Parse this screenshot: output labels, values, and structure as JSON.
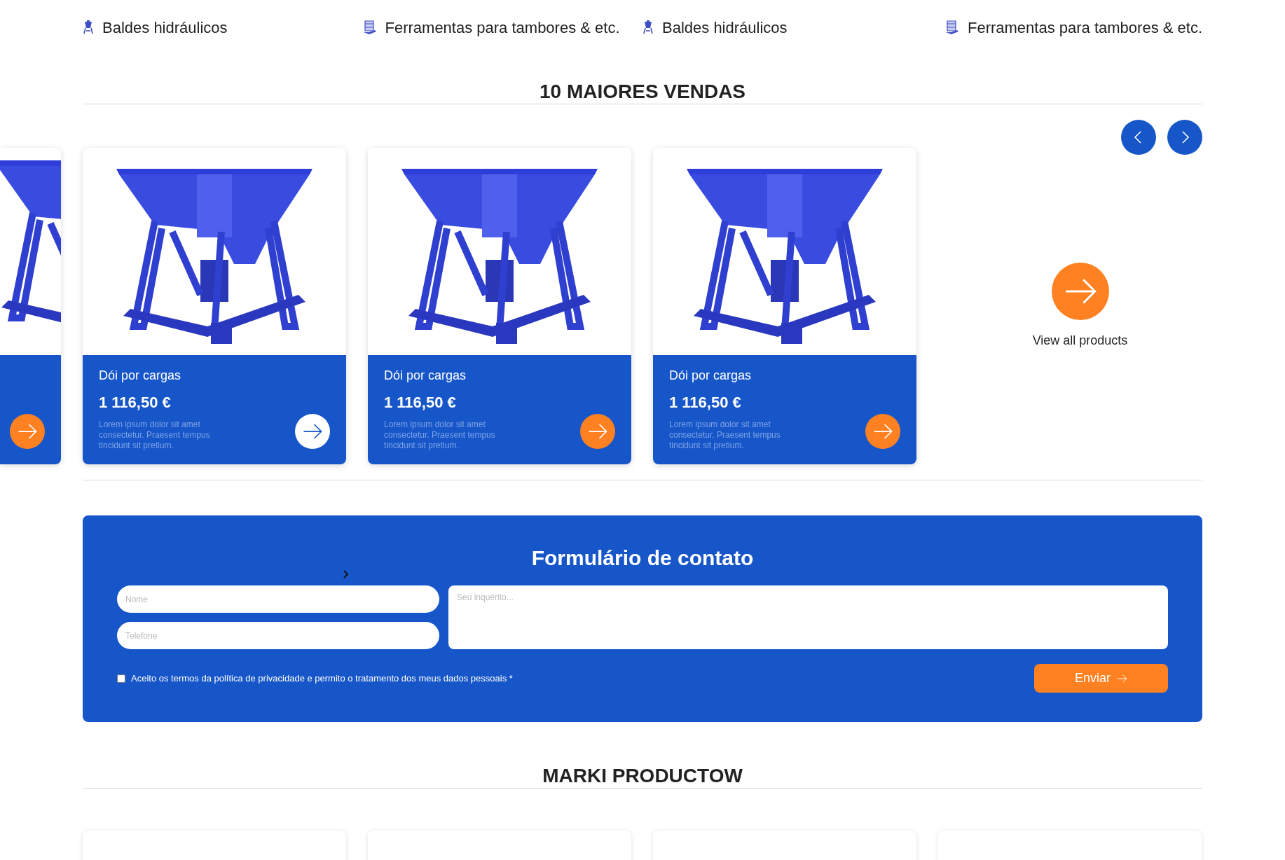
{
  "categories": [
    {
      "label": "Baldes hidráulicos",
      "kind": "bucket"
    },
    {
      "label": "Ferramentas para tambores & etc.",
      "kind": "drum"
    },
    {
      "label": "Baldes hidráulicos",
      "kind": "bucket"
    },
    {
      "label": "Ferramentas para tambores & etc.",
      "kind": "drum"
    }
  ],
  "bestsellers": {
    "title": "10 MAIORES VENDAS",
    "products": [
      {
        "name": "Dói por cargas",
        "price": "1 116,50 €",
        "description": "Lorem ipsum dolor sit amet consectetur. Praesent tempus tincidunt sit pretium.",
        "active": true
      },
      {
        "name": "Dói por cargas",
        "price": "1 116,50 €",
        "description": "Lorem ipsum dolor sit amet consectetur. Praesent tempus tincidunt sit pretium.",
        "active": false
      },
      {
        "name": "Dói por cargas",
        "price": "1 116,50 €",
        "description": "Lorem ipsum dolor sit amet consectetur. Praesent tempus tincidunt sit pretium.",
        "active": false
      }
    ],
    "view_all": "View all products"
  },
  "contact_form": {
    "title": "Formulário de contato",
    "fields": [
      {
        "placeholder": "Nome"
      },
      {
        "placeholder": "Telefone"
      }
    ],
    "message": {
      "placeholder": "Seu inquérito..."
    },
    "consent": {
      "label": "Aceito os termos da política de privacidade e permito o tratamento dos meus dados pessoais *",
      "checked": false
    },
    "submit": "Enviar"
  },
  "brands": {
    "title": "MARKI PRODUCTOW"
  }
}
